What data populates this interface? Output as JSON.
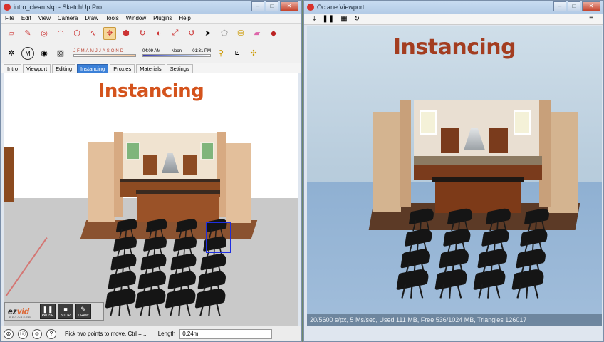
{
  "sketchup": {
    "title": "intro_clean.skp - SketchUp Pro",
    "menu": [
      "File",
      "Edit",
      "View",
      "Camera",
      "Draw",
      "Tools",
      "Window",
      "Plugins",
      "Help"
    ],
    "shadow": {
      "months": [
        "J",
        "F",
        "M",
        "A",
        "M",
        "J",
        "J",
        "A",
        "S",
        "O",
        "N",
        "D"
      ],
      "time_start": "04:09 AM",
      "time_mid": "Noon",
      "time_end": "01:31 PM"
    },
    "tabs": [
      {
        "label": "Intro",
        "active": false
      },
      {
        "label": "Viewport",
        "active": false
      },
      {
        "label": "Editing",
        "active": false
      },
      {
        "label": "Instancing",
        "active": true
      },
      {
        "label": "Proxies",
        "active": false
      },
      {
        "label": "Materials",
        "active": false
      },
      {
        "label": "Settings",
        "active": false
      }
    ],
    "scene_title": "Instancing",
    "status_hint": "Pick two points to move.  Ctrl = ...",
    "length_label": "Length",
    "length_value": "0.24m"
  },
  "recorder": {
    "logo_main": "ez",
    "logo_accent": "vid",
    "subtitle": "RECORDER",
    "buttons": [
      "PAUSE",
      "STOP",
      "DRAW"
    ]
  },
  "octane": {
    "title": "Octane Viewport",
    "scene_title": "Instancing",
    "status": "20/5600 s/px, 5 Ms/sec, Used 111 MB, Free 536/1024 MB, Triangles 126017"
  },
  "caption_buttons": {
    "minimize": "–",
    "maximize": "□",
    "close": "✕"
  }
}
